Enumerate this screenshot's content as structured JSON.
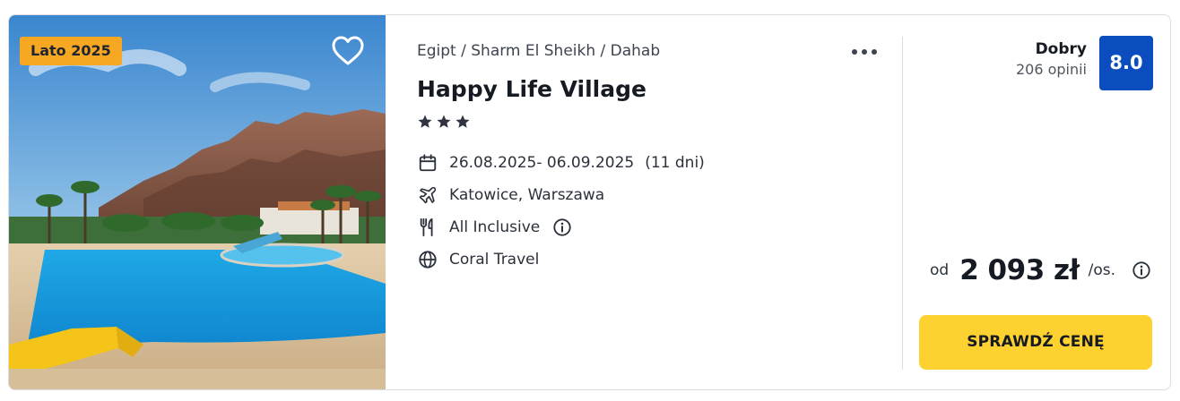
{
  "offer": {
    "badge": "Lato 2025",
    "breadcrumb": "Egipt / Sharm El Sheikh / Dahab",
    "hotel_name": "Happy Life Village",
    "stars": 3,
    "dates": "26.08.2025- 06.09.2025",
    "duration": "(11 dni)",
    "departure": "Katowice, Warszawa",
    "board": "All Inclusive",
    "operator": "Coral Travel"
  },
  "rating": {
    "label": "Dobry",
    "count": "206 opinii",
    "score": "8.0"
  },
  "price": {
    "prefix": "od",
    "value": "2 093 zł",
    "unit": "/os."
  },
  "cta_label": "SPRAWDŹ CENĘ",
  "icons": {
    "favorite": "heart-icon",
    "more": "more-dots-icon",
    "dates": "calendar-icon",
    "departure": "plane-icon",
    "board": "cutlery-icon",
    "board_info": "info-icon",
    "operator": "globe-icon",
    "price_info": "info-icon",
    "stars": "star-icon"
  },
  "colors": {
    "badge_bg": "#f7a823",
    "rating_bg": "#0b4dbf",
    "cta_bg": "#fdd12f",
    "text_dark": "#161a22"
  }
}
